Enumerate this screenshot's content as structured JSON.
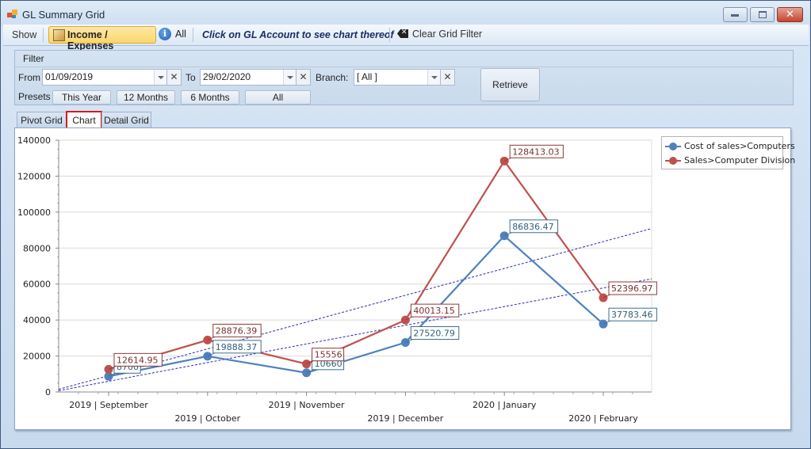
{
  "window": {
    "title": "GL Summary Grid",
    "controls": [
      "minimize-icon",
      "maximize-icon",
      "close-icon"
    ]
  },
  "toolbar": {
    "show_label": "Show",
    "income_expenses_label": "Income / Expenses",
    "all_label": "All",
    "hint": "Click on GL Account to see chart thereof",
    "clear_filter_label": "Clear Grid Filter",
    "income_expenses_active": true
  },
  "filter": {
    "title": "Filter",
    "from_label": "From",
    "from_value": "01/09/2019",
    "to_label": "To",
    "to_value": "29/02/2020",
    "branch_label": "Branch:",
    "branch_value": "[ All ]",
    "presets_label": "Presets",
    "presets": [
      "This Year",
      "12 Months",
      "6 Months",
      "All"
    ],
    "retrieve_label": "Retrieve"
  },
  "tabs": [
    {
      "label": "Pivot Grid",
      "active": false
    },
    {
      "label": "Chart",
      "active": true
    },
    {
      "label": "Detail Grid",
      "active": false
    }
  ],
  "colors": {
    "series_cost": "#4f81bd",
    "series_sales": "#c0504d",
    "trendline": "#2b2bb8",
    "active_tab_border": "#d01c24"
  },
  "chart_data": {
    "type": "line",
    "title": "",
    "xlabel": "",
    "ylabel": "",
    "categories": [
      "2019 | September",
      "2019 | October",
      "2019 | November",
      "2019 | December",
      "2020 | January",
      "2020 | February"
    ],
    "series": [
      {
        "name": "Cost of sales>Computers",
        "color": "#4f81bd",
        "values": [
          8700,
          19888.37,
          10660,
          27520.79,
          86836.47,
          37783.46
        ],
        "labels": [
          "8700",
          "19888.37",
          "10660",
          "27520.79",
          "86836.47",
          "37783.46"
        ]
      },
      {
        "name": "Sales>Computer Division",
        "color": "#c0504d",
        "values": [
          12614.95,
          28876.39,
          15556,
          40013.15,
          128413.03,
          52396.97
        ],
        "labels": [
          "12614.95",
          "28876.39",
          "15556",
          "40013.15",
          "128413.03",
          "52396.97"
        ]
      }
    ],
    "trendlines": [
      {
        "series": "Cost of sales>Computers",
        "type": "linear",
        "dashed": true
      },
      {
        "series": "Sales>Computer Division",
        "type": "linear",
        "dashed": true
      }
    ],
    "ylim": [
      0,
      140000
    ],
    "yticks": [
      0,
      20000,
      40000,
      60000,
      80000,
      100000,
      120000,
      140000
    ],
    "grid": true,
    "legend": "top-right"
  }
}
